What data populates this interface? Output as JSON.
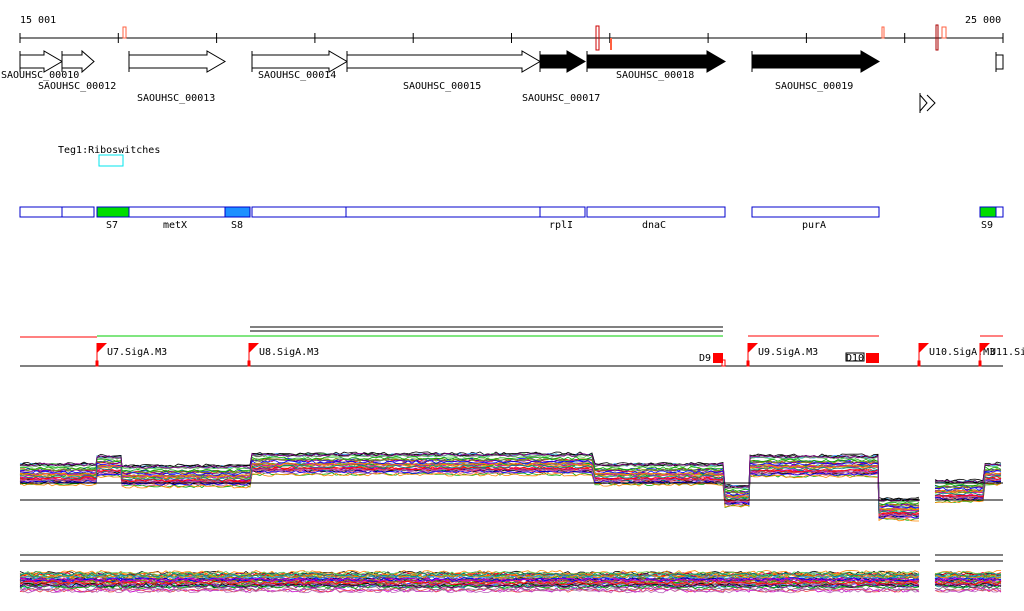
{
  "ruler": {
    "start_label": "15 001",
    "end_label": "25 000"
  },
  "genes": [
    {
      "label": "SAOUHSC_00010",
      "strand": "+",
      "filled": false
    },
    {
      "label": "SAOUHSC_00012",
      "strand": "+",
      "filled": false
    },
    {
      "label": "SAOUHSC_00013",
      "strand": "+",
      "filled": false
    },
    {
      "label": "SAOUHSC_00014",
      "strand": "+",
      "filled": false
    },
    {
      "label": "SAOUHSC_00015",
      "strand": "+",
      "filled": false
    },
    {
      "label": "SAOUHSC_00017",
      "strand": "+",
      "filled": true
    },
    {
      "label": "SAOUHSC_00018",
      "strand": "+",
      "filled": true
    },
    {
      "label": "SAOUHSC_00019",
      "strand": "+",
      "filled": true
    }
  ],
  "riboswitch_track": {
    "label": "Teg1:Riboswitches"
  },
  "features": [
    {
      "label": "S7",
      "color": "#00dd00"
    },
    {
      "label": "metX",
      "color": "#ffffff"
    },
    {
      "label": "S8",
      "color": "#1e90ff"
    },
    {
      "label": "rplI",
      "color": "#ffffff"
    },
    {
      "label": "dnaC",
      "color": "#ffffff"
    },
    {
      "label": "purA",
      "color": "#ffffff"
    },
    {
      "label": "S9",
      "color": "#00dd00"
    }
  ],
  "promoters": [
    {
      "label": "U7.SigA.M3"
    },
    {
      "label": "U8.SigA.M3"
    },
    {
      "label": "U9.SigA.M3"
    },
    {
      "label": "U10.SigA.M3"
    },
    {
      "label": "U11.Si"
    }
  ],
  "terminators": [
    {
      "label": "D9"
    },
    {
      "label": "D10"
    }
  ],
  "colors": {
    "promoter": "#ff0000",
    "feature_outline": "#0000cc",
    "riboswitch": "#00e5ee"
  }
}
